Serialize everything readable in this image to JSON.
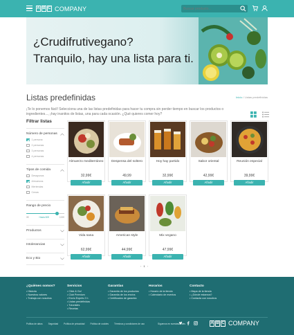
{
  "header": {
    "brand_letters": [
      "A",
      "B",
      "C"
    ],
    "brand_name": "COMPANY",
    "search_placeholder": "Buscar producto...",
    "colors": {
      "bar": "#3bb3b0"
    },
    "icons": [
      "menu-icon",
      "search-icon",
      "cart-icon",
      "user-icon"
    ]
  },
  "hero": {
    "line1": "¿Crudifrutivegano?",
    "line2": "Tranquilo, hay una lista para ti."
  },
  "page": {
    "title": "Listas predefinidas",
    "breadcrumb_home": "Inicio",
    "breadcrumb_sep": " / ",
    "breadcrumb_current": "Listas predefinidas",
    "intro": "¡Te lo ponemos fácil! Selecciona una de las listas predefinidas para hacer tu compra sin perder tiempo en buscar los productos o ingredientes..., ¡hay inanitos de listas, una para cada ocasión. ¿Qué quieres comer hoy?"
  },
  "filters": {
    "title": "Filtrar listas",
    "people": {
      "label": "Número de personas",
      "options": [
        {
          "label": "1 persona",
          "checked": true
        },
        {
          "label": "2 personas",
          "checked": false
        },
        {
          "label": "3 personas",
          "checked": false
        },
        {
          "label": "4 personas",
          "checked": false
        }
      ]
    },
    "meal": {
      "label": "Tipos de comida",
      "options": [
        {
          "label": "Desayunos",
          "checked": false
        },
        {
          "label": "Almuerzos",
          "checked": true
        },
        {
          "label": "Meriendas",
          "checked": false
        },
        {
          "label": "Cenas",
          "checked": false
        }
      ]
    },
    "price": {
      "label": "Rango de precio",
      "min": "0€",
      "selected": "Hasta 80€",
      "max": "100€",
      "value_fraction": 0.8
    },
    "products_label": "Productos",
    "intolerances_label": "Intolerancias",
    "eco_label": "Eco y Bio"
  },
  "products": [
    {
      "name": "Almuerzo mediterráneo",
      "price": "32,99€",
      "button": "Añadir"
    },
    {
      "name": "Despensa del soltero",
      "price": "49,99",
      "button": "Añadir"
    },
    {
      "name": "Hoy hay partido",
      "price": "32,99€",
      "button": "Añadir"
    },
    {
      "name": "Sabor oriental",
      "price": "42,99€",
      "button": "Añadir"
    },
    {
      "name": "Reunión especial",
      "price": "39,99€",
      "button": "Añadir"
    },
    {
      "name": "Vida sana",
      "price": "62,99€",
      "button": "Añadir"
    },
    {
      "name": "American style",
      "price": "44,99€",
      "button": "Añadir"
    },
    {
      "name": "Mix vegano",
      "price": "47,99€",
      "button": "Añadir"
    }
  ],
  "pager": {
    "prev": "‹",
    "page1": "1",
    "next": "›"
  },
  "footer": {
    "cols": [
      {
        "title": "¿Quiénes somos?",
        "items": [
          "Historia",
          "Nuestros valores",
          "Trabaja con nosotros"
        ]
      },
      {
        "title": "Servicios",
        "items": [
          "Click & Go!",
          "Club Premium",
          "Envío Exprés 2 h",
          "Listas predefinidas",
          "Tutoriales",
          "Recetas"
        ]
      },
      {
        "title": "Garantías",
        "items": [
          "Garantía de los productos",
          "Garantía de los envíos",
          "Certificados de garantía"
        ]
      },
      {
        "title": "Horarios",
        "items": [
          "Horario de la tienda",
          "Calendario de eventos"
        ]
      },
      {
        "title": "Contacto",
        "items": [
          "Mapa de la tienda",
          "¿Dónde estamos?",
          "Contacta con nosotros"
        ]
      }
    ],
    "legal": [
      "Política de datos",
      "Seguridad",
      "Política de privacidad",
      "Política de cookies",
      "Términos y condiciones de uso"
    ],
    "follow": "Síguenos en nuestras redes",
    "social_icons": [
      "twitter-icon",
      "facebook-icon",
      "instagram-icon"
    ],
    "colors": {
      "bg": "#1f6d72"
    }
  }
}
